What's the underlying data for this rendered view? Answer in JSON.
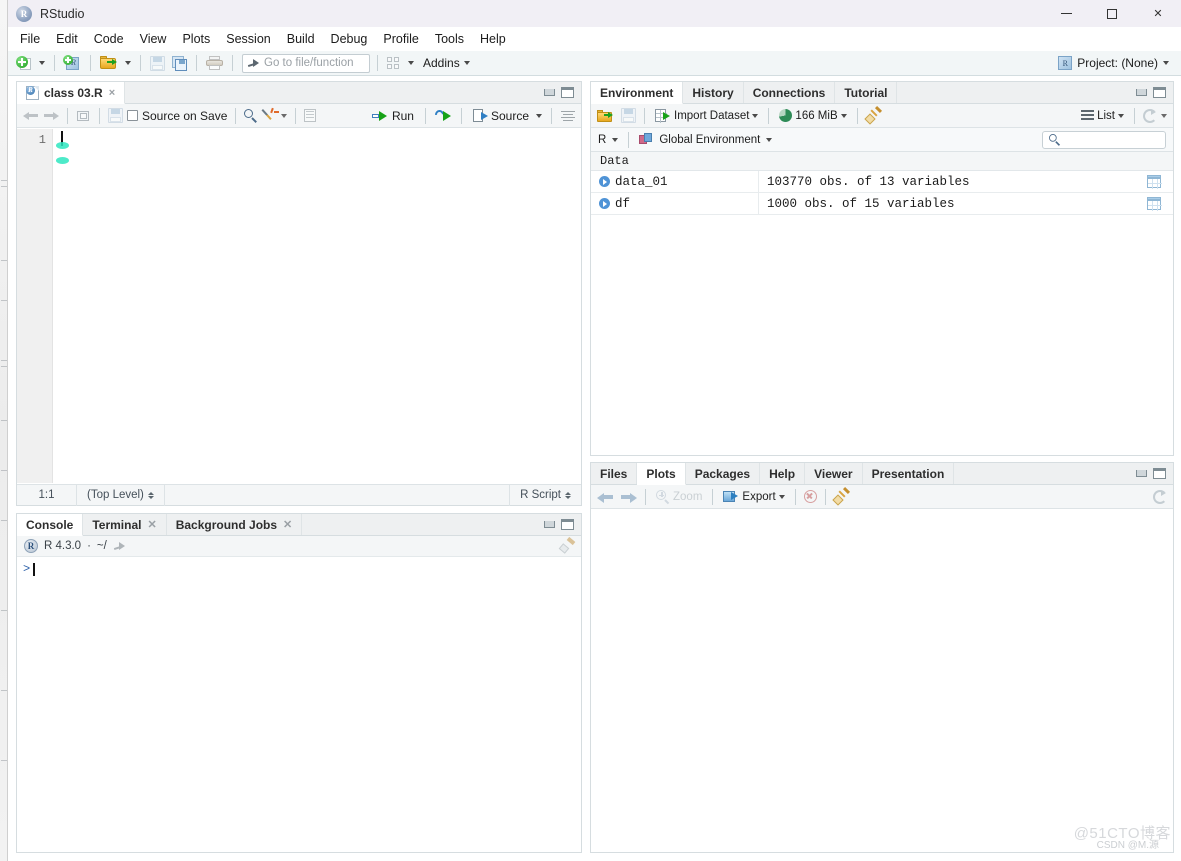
{
  "window": {
    "title": "RStudio",
    "app_icon": "r-logo-icon",
    "controls": {
      "minimize": "minimize",
      "maximize": "maximize",
      "close": "close"
    }
  },
  "menubar": {
    "items": [
      "File",
      "Edit",
      "Code",
      "View",
      "Plots",
      "Session",
      "Build",
      "Debug",
      "Profile",
      "Tools",
      "Help"
    ]
  },
  "toolbar": {
    "new_file": "new-file-icon",
    "new_project": "new-project-icon",
    "open_file": "open-file-icon",
    "save": "save-icon",
    "save_all": "save-all-icon",
    "print": "print-icon",
    "goto_placeholder": "Go to file/function",
    "panes_layout": "panes-layout-icon",
    "addins_label": "Addins",
    "project_label": "Project: (None)"
  },
  "source": {
    "tab_label": "class 03.R",
    "tab_close": "×",
    "back": "back-arrow",
    "forward": "forward-arrow",
    "popout": "show-in-new-window",
    "save": "save-icon",
    "source_on_save_label": "Source on Save",
    "find": "find-icon",
    "code_tools": "code-tools-icon",
    "outline": "document-outline-icon",
    "run_label": "Run",
    "rerun": "re-run-icon",
    "source_label": "Source",
    "align_icon": "show-outline-icon",
    "line_numbers": [
      "1"
    ],
    "code_lines": [
      ""
    ],
    "status": {
      "cursor_position": "1:1",
      "scope": "(Top Level)",
      "file_type": "R Script"
    }
  },
  "console": {
    "tabs": [
      {
        "label": "Console",
        "active": true,
        "closable": false
      },
      {
        "label": "Terminal",
        "active": false,
        "closable": true
      },
      {
        "label": "Background Jobs",
        "active": false,
        "closable": true
      }
    ],
    "r_version": "R 4.3.0",
    "working_dir": "~/",
    "clear_icon": "clear-console-icon",
    "prompt": ">",
    "input_value": ""
  },
  "environment": {
    "tabs": [
      {
        "label": "Environment",
        "active": true
      },
      {
        "label": "History",
        "active": false
      },
      {
        "label": "Connections",
        "active": false
      },
      {
        "label": "Tutorial",
        "active": false
      }
    ],
    "toolbar": {
      "load_workspace": "load-workspace-icon",
      "save_workspace": "save-workspace-icon",
      "import_dataset_label": "Import Dataset",
      "memory_label": "166 MiB",
      "clear_objects": "clear-objects-icon",
      "view_mode_label": "List",
      "refresh": "refresh-icon"
    },
    "scope": {
      "language": "R",
      "environment_label": "Global Environment",
      "search_placeholder": ""
    },
    "section_title": "Data",
    "rows": [
      {
        "name": "data_01",
        "value": "103770 obs. of 13 variables",
        "has_grid": true
      },
      {
        "name": "df",
        "value": "1000 obs. of 15 variables",
        "has_grid": true
      }
    ]
  },
  "plots": {
    "tabs": [
      {
        "label": "Files",
        "active": false
      },
      {
        "label": "Plots",
        "active": true
      },
      {
        "label": "Packages",
        "active": false
      },
      {
        "label": "Help",
        "active": false
      },
      {
        "label": "Viewer",
        "active": false
      },
      {
        "label": "Presentation",
        "active": false
      }
    ],
    "toolbar": {
      "prev": "previous-plot-icon",
      "next": "next-plot-icon",
      "zoom_label": "Zoom",
      "export_label": "Export",
      "remove": "remove-plot-icon",
      "clear_all": "clear-all-plots-icon",
      "refresh": "refresh-icon"
    },
    "empty": ""
  },
  "watermarks": {
    "primary": "@51CTO博客",
    "secondary": "CSDN @M.源"
  },
  "colors": {
    "titlebar": "#f1eff5",
    "toolbar": "#f2f6f7",
    "pane_border": "#d6dde0",
    "tab_inactive": "#eef0f1",
    "accent_blue": "#4f93d6",
    "accent_green": "#1fa01f",
    "cursor_highlight": "#2ee6c0"
  }
}
